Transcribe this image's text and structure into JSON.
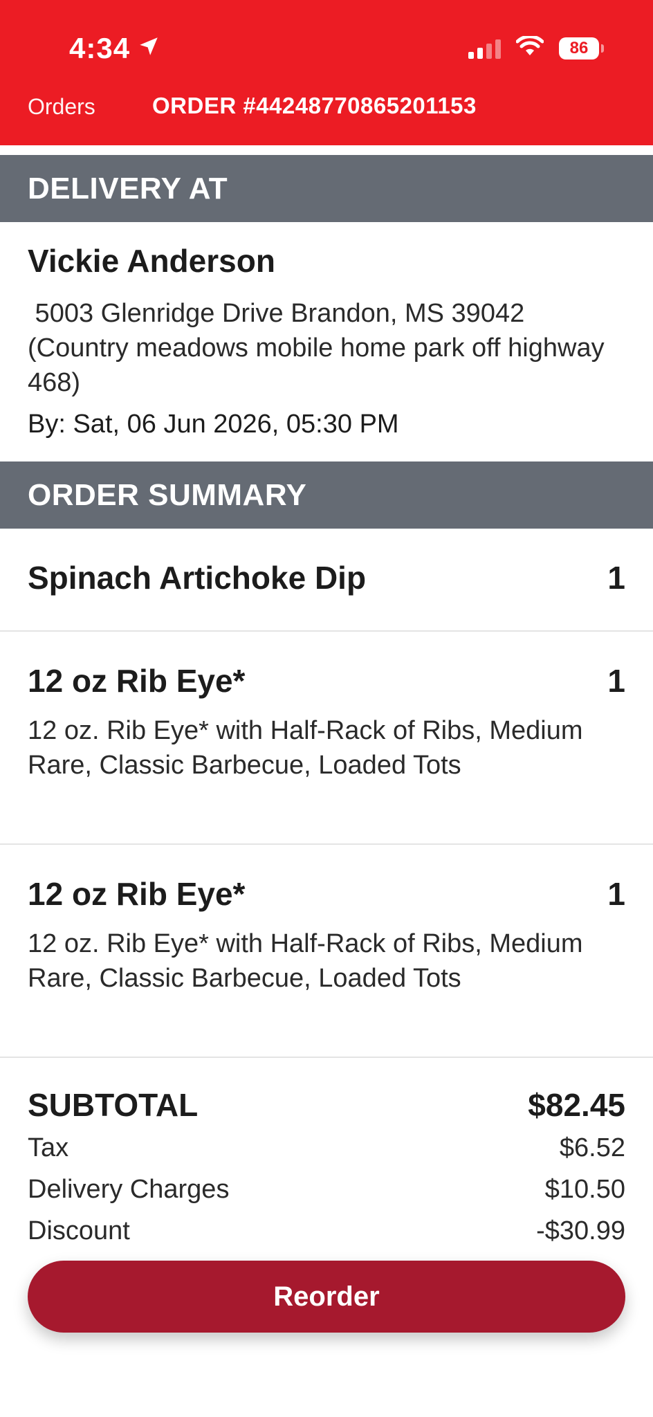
{
  "status_bar": {
    "time": "4:34",
    "battery": "86"
  },
  "nav": {
    "back_label": "Orders",
    "title": "ORDER #44248770865201153"
  },
  "delivery": {
    "header": "DELIVERY AT",
    "name": "Vickie Anderson",
    "address_line1": " 5003 Glenridge Drive Brandon, MS 39042",
    "address_line2": "(Country meadows mobile home park off highway 468)",
    "by": "By: Sat, 06 Jun 2026, 05:30 PM"
  },
  "summary": {
    "header": "ORDER SUMMARY",
    "items": [
      {
        "name": "Spinach Artichoke Dip",
        "qty": "1",
        "desc": ""
      },
      {
        "name": "12 oz Rib Eye*",
        "qty": "1",
        "desc": "12 oz. Rib Eye* with Half-Rack of Ribs, Medium Rare, Classic Barbecue, Loaded Tots"
      },
      {
        "name": "12 oz Rib Eye*",
        "qty": "1",
        "desc": "12 oz. Rib Eye* with Half-Rack of Ribs, Medium Rare, Classic Barbecue, Loaded Tots"
      }
    ]
  },
  "totals": {
    "subtotal_label": "SUBTOTAL",
    "subtotal_value": "$82.45",
    "tax_label": "Tax",
    "tax_value": "$6.52",
    "delivery_label": "Delivery Charges",
    "delivery_value": "$10.50",
    "discount_label": "Discount",
    "discount_value": "-$30.99"
  },
  "actions": {
    "reorder_label": "Reorder"
  },
  "colors": {
    "brand_red": "#ec1c24",
    "header_gray": "#656b74",
    "button_red": "#a6192e"
  }
}
